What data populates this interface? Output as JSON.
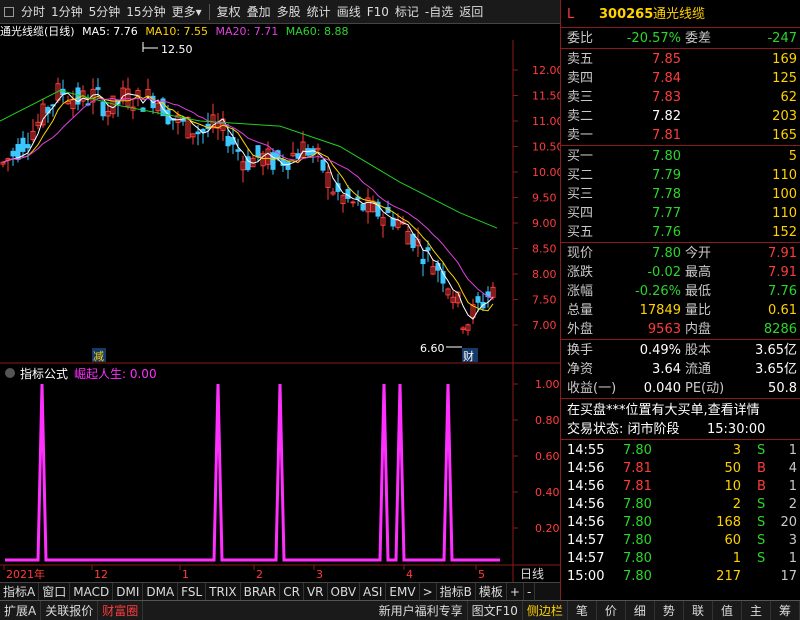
{
  "toolbar": {
    "items": [
      "分时",
      "1分钟",
      "5分钟",
      "15分钟",
      "更多"
    ],
    "more_arrow": "▾",
    "right_items": [
      "复权",
      "叠加",
      "多股",
      "统计",
      "画线",
      "F10",
      "标记",
      "-自选",
      "返回"
    ]
  },
  "kline": {
    "title": "通光线缆(日线)",
    "ma5": "MA5: 7.76",
    "ma10": "MA10: 7.55",
    "ma20": "MA20: 7.71",
    "ma60": "MA60: 8.88",
    "high_label": "12.50",
    "low_label": "6.60",
    "mark_jian": "减",
    "mark_cai": "财",
    "y_ticks": [
      "12.00",
      "11.50",
      "11.00",
      "10.50",
      "10.00",
      "9.50",
      "9.00",
      "8.50",
      "8.00",
      "7.50",
      "7.00"
    ]
  },
  "indicator": {
    "title": "指标公式",
    "name": "崛起人生: 0.00",
    "y_ticks": [
      "1.00",
      "0.80",
      "0.60",
      "0.40",
      "0.20"
    ]
  },
  "x_axis": {
    "labels": [
      "2021年",
      "12",
      "1",
      "2",
      "3",
      "4",
      "5"
    ],
    "period": "日线"
  },
  "tabs": [
    "指标A",
    "窗口",
    "MACD",
    "DMI",
    "DMA",
    "FSL",
    "TRIX",
    "BRAR",
    "CR",
    "VR",
    "OBV",
    "ASI",
    "EMV",
    ">",
    "指标B",
    "模板",
    "+",
    "-"
  ],
  "status_bar": {
    "left": [
      "扩展A",
      "关联报价",
      "财富圈"
    ],
    "middle": [
      "新用户福利专享",
      "图文F10",
      "侧边栏"
    ],
    "icons": [
      "笔",
      "价",
      "细",
      "势",
      "联",
      "值",
      "主",
      "筹"
    ]
  },
  "quote": {
    "flag": "L",
    "code": "300265",
    "name": "通光线缆",
    "weibi_label": "委比",
    "weibi": "-20.57%",
    "weicha_label": "委差",
    "weicha": "-247",
    "asks": [
      {
        "label": "卖五",
        "price": "7.85",
        "vol": "169"
      },
      {
        "label": "卖四",
        "price": "7.84",
        "vol": "125"
      },
      {
        "label": "卖三",
        "price": "7.83",
        "vol": "62"
      },
      {
        "label": "卖二",
        "price": "7.82",
        "vol": "203"
      },
      {
        "label": "卖一",
        "price": "7.81",
        "vol": "165"
      }
    ],
    "bids": [
      {
        "label": "买一",
        "price": "7.80",
        "vol": "5"
      },
      {
        "label": "买二",
        "price": "7.79",
        "vol": "110"
      },
      {
        "label": "买三",
        "price": "7.78",
        "vol": "100"
      },
      {
        "label": "买四",
        "price": "7.77",
        "vol": "110"
      },
      {
        "label": "买五",
        "price": "7.76",
        "vol": "152"
      }
    ],
    "stats": [
      {
        "l1": "现价",
        "v1": "7.80",
        "l2": "今开",
        "v2": "7.91"
      },
      {
        "l1": "涨跌",
        "v1": "-0.02",
        "l2": "最高",
        "v2": "7.91"
      },
      {
        "l1": "涨幅",
        "v1": "-0.26%",
        "l2": "最低",
        "v2": "7.76"
      },
      {
        "l1": "总量",
        "v1": "17849",
        "l2": "量比",
        "v2": "0.61"
      },
      {
        "l1": "外盘",
        "v1": "9563",
        "l2": "内盘",
        "v2": "8286"
      }
    ],
    "stats2": [
      {
        "l1": "换手",
        "v1": "0.49%",
        "l2": "股本",
        "v2": "3.65亿"
      },
      {
        "l1": "净资",
        "v1": "3.64",
        "l2": "流通",
        "v2": "3.65亿"
      },
      {
        "l1": "收益(一)",
        "v1": "0.040",
        "l2": "PE(动)",
        "v2": "50.8"
      }
    ],
    "notice": "在买盘***位置有大买单,查看详情",
    "trade_state_label": "交易状态: 闭市阶段",
    "trade_state_time": "15:30:00",
    "ticks": [
      {
        "time": "14:55",
        "price": "7.80",
        "vol": "3",
        "bs": "S",
        "n": "1"
      },
      {
        "time": "14:56",
        "price": "7.81",
        "vol": "50",
        "bs": "B",
        "n": "4"
      },
      {
        "time": "14:56",
        "price": "7.81",
        "vol": "10",
        "bs": "B",
        "n": "1"
      },
      {
        "time": "14:56",
        "price": "7.80",
        "vol": "2",
        "bs": "S",
        "n": "2"
      },
      {
        "time": "14:56",
        "price": "7.80",
        "vol": "168",
        "bs": "S",
        "n": "20"
      },
      {
        "time": "14:57",
        "price": "7.80",
        "vol": "60",
        "bs": "S",
        "n": "3"
      },
      {
        "time": "14:57",
        "price": "7.80",
        "vol": "1",
        "bs": "S",
        "n": "1"
      },
      {
        "time": "15:00",
        "price": "7.80",
        "vol": "217",
        "bs": "",
        "n": "17"
      }
    ]
  },
  "colors": {
    "up": "#ff3c3c",
    "down": "#2bd62b",
    "ma5": "#ffffff",
    "ma10": "#ffd200",
    "ma20": "#e040e0",
    "ma60": "#20d020",
    "axis": "#8b1a1a",
    "signal": "#ff30ff"
  }
}
